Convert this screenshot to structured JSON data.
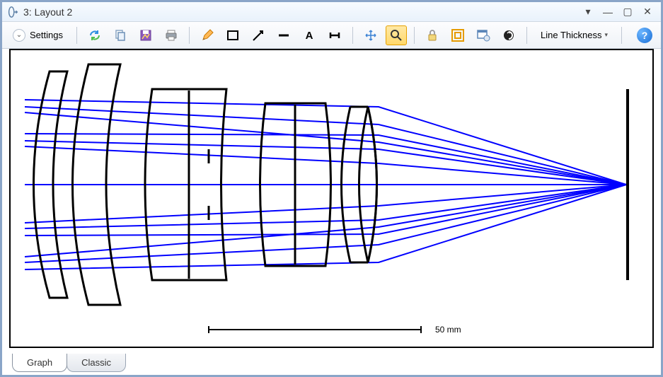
{
  "window": {
    "title": "3: Layout 2"
  },
  "toolbar": {
    "settings_label": "Settings",
    "line_thickness_label": "Line Thickness"
  },
  "tabs": {
    "graph": "Graph",
    "classic": "Classic"
  },
  "canvas": {
    "scale_label": "50 mm"
  },
  "colors": {
    "ray": "#0000ff",
    "lens_outline": "#000000"
  },
  "chart_data": {
    "type": "diagram",
    "description": "Optical lens layout with ray trace",
    "scale_mm": 50,
    "focal_point_approx_mm": 145,
    "ray_color": "blue",
    "elements": [
      {
        "type": "meniscus",
        "approx_center_mm": 8
      },
      {
        "type": "meniscus",
        "approx_center_mm": 18
      },
      {
        "type": "doublet_block",
        "approx_center_mm": 38
      },
      {
        "type": "doublet_block",
        "approx_center_mm": 68
      },
      {
        "type": "biconvex",
        "approx_center_mm": 85
      },
      {
        "type": "image_plane",
        "approx_center_mm": 150
      }
    ]
  }
}
